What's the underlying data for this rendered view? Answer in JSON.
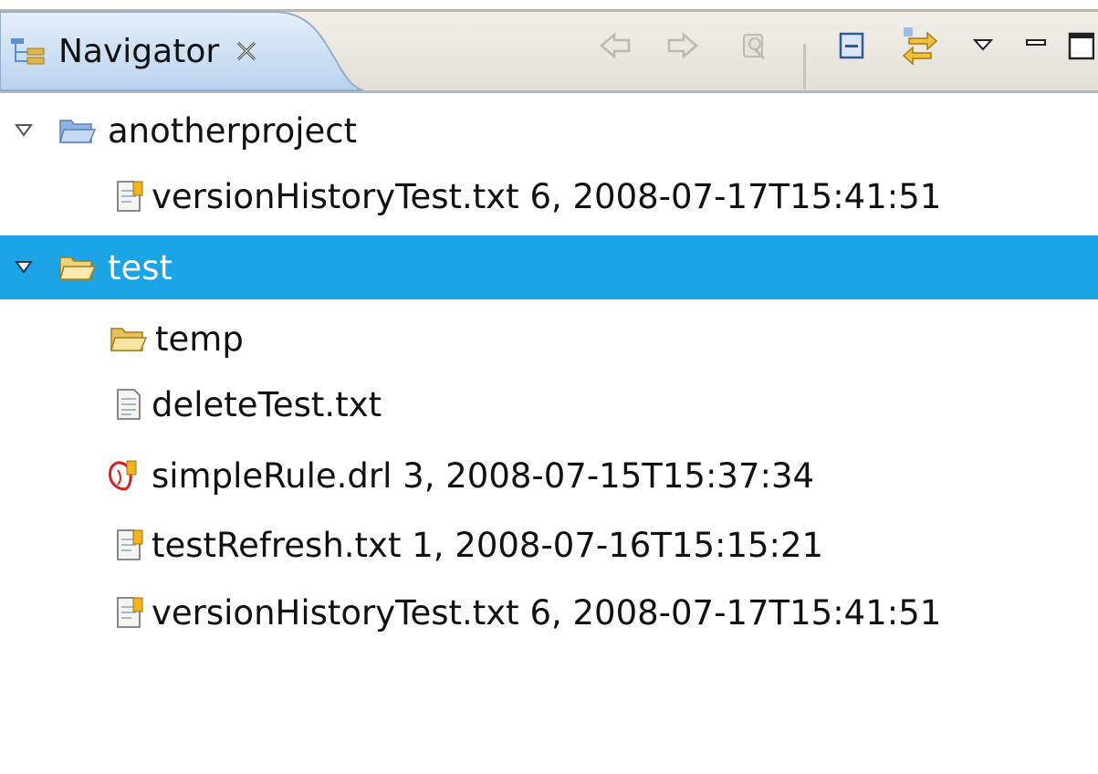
{
  "view": {
    "title": "Navigator",
    "close_icon": "close-x-icon",
    "toolbar": [
      {
        "name": "back-icon",
        "enabled": false
      },
      {
        "name": "forward-icon",
        "enabled": false
      },
      {
        "name": "up-icon",
        "enabled": false
      },
      {
        "name": "collapse-all-icon",
        "enabled": true
      },
      {
        "name": "link-with-editor-icon",
        "enabled": true
      },
      {
        "name": "view-menu-icon",
        "enabled": true
      },
      {
        "name": "minimize-icon",
        "enabled": true
      },
      {
        "name": "maximize-icon",
        "enabled": true
      }
    ]
  },
  "tree": [
    {
      "label": "anotherproject",
      "type": "project",
      "expanded": true,
      "selected": false
    },
    {
      "label": "versionHistoryTest.txt 6, 2008-07-17T15:41:51",
      "type": "versioned-file",
      "selected": false
    },
    {
      "label": "test",
      "type": "project",
      "expanded": true,
      "selected": true
    },
    {
      "label": "temp",
      "type": "folder",
      "selected": false
    },
    {
      "label": "deleteTest.txt",
      "type": "file",
      "selected": false
    },
    {
      "label": "simpleRule.drl 3, 2008-07-15T15:37:34",
      "type": "rule-file",
      "selected": false
    },
    {
      "label": "testRefresh.txt 1, 2008-07-16T15:15:21",
      "type": "versioned-file",
      "selected": false
    },
    {
      "label": "versionHistoryTest.txt 6, 2008-07-17T15:41:51",
      "type": "versioned-file",
      "selected": false
    }
  ],
  "colors": {
    "selection": "#1ba4e6",
    "active_tab": "#cfe3f7",
    "header_bg": "#ebe8e2"
  }
}
